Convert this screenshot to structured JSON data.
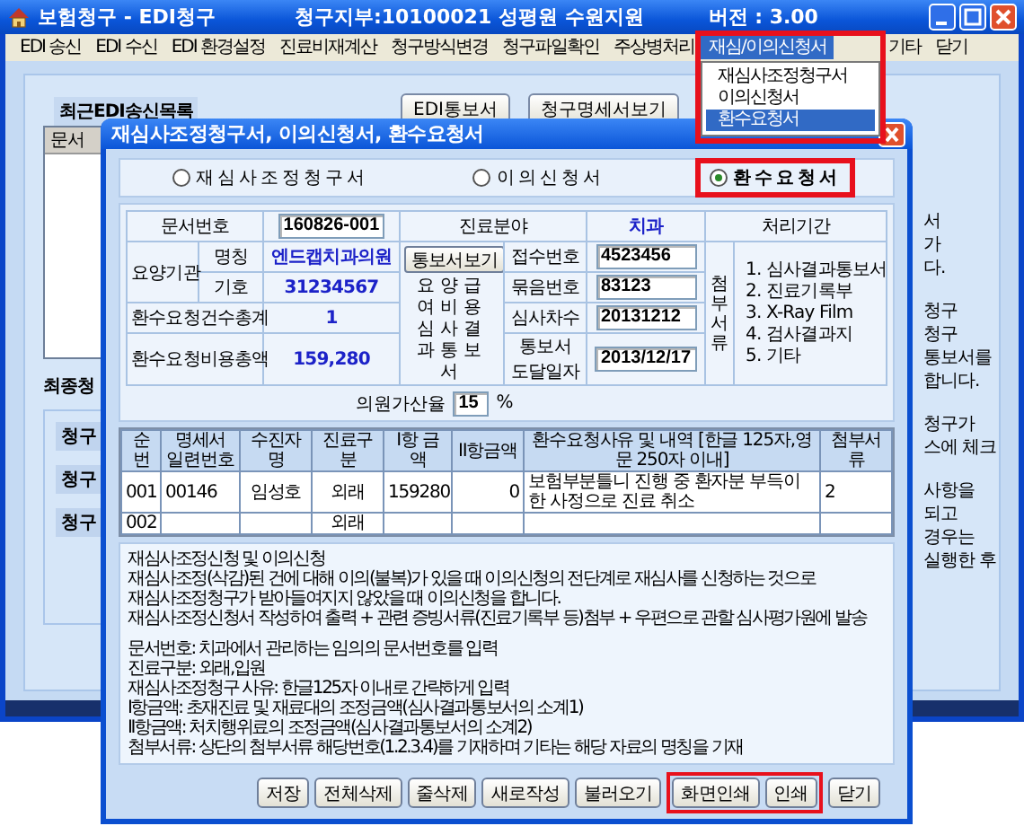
{
  "window": {
    "title": "보험청구 - EDI청구",
    "branch": "청구지부:10100021 성평원 수원지원",
    "version": "버전 : 3.00"
  },
  "menu": [
    {
      "label": "EDI 송신",
      "selected": false,
      "highlighted": false
    },
    {
      "label": "EDI 수신",
      "selected": false,
      "highlighted": false
    },
    {
      "label": "EDI 환경설정",
      "selected": false,
      "highlighted": false
    },
    {
      "label": "진료비재계산",
      "selected": false,
      "highlighted": false
    },
    {
      "label": "청구방식변경",
      "selected": false,
      "highlighted": false
    },
    {
      "label": "청구파일확인",
      "selected": false,
      "highlighted": false
    },
    {
      "label": "주상병처리",
      "selected": false,
      "highlighted": false
    },
    {
      "label": "재심/이의신청서",
      "selected": true,
      "highlighted": true
    },
    {
      "label": "기타",
      "selected": false,
      "highlighted": false
    },
    {
      "label": "닫기",
      "selected": false,
      "highlighted": false
    }
  ],
  "dropdown": [
    {
      "label": "재심사조정청구서",
      "selected": false
    },
    {
      "label": "이의신청서",
      "selected": false
    },
    {
      "label": "환수요청서",
      "selected": true
    }
  ],
  "background": {
    "list_title": "최근EDI송신목록",
    "list_header": "문서",
    "buttons": [
      "EDI통보서",
      "청구명세서보기"
    ],
    "final_title": "최종청",
    "final_labels": [
      "청구",
      "청구",
      "청구"
    ],
    "side_text": [
      [
        "서",
        "가",
        "다."
      ],
      [
        "청구",
        "청구",
        "통보서를",
        "합니다."
      ],
      [
        "청구가",
        "스에 체크"
      ],
      [
        "사항을",
        "되고",
        "경우는",
        "실행한 후"
      ]
    ]
  },
  "dialog": {
    "title": "재심사조정청구서, 이의신청서, 환수요청서",
    "form_types": [
      {
        "label": "재심사조정청구서",
        "selected": false,
        "highlighted": false
      },
      {
        "label": "이의신청서",
        "selected": false,
        "highlighted": false
      },
      {
        "label": "환수요청서",
        "selected": true,
        "highlighted": true
      }
    ],
    "form": {
      "doc_no_label": "문서번호",
      "doc_no": "160826-001",
      "field_label": "진료분야",
      "field": "치과",
      "period_label": "처리기간",
      "institution_label": "요양기관",
      "name_label": "명칭",
      "name": "엔드캡치과의원",
      "code_label": "기호",
      "code": "31234567",
      "notice_button": "통보서보기",
      "notice_label": "요양급여비용심사결과통보서",
      "receipt_label": "접수번호",
      "receipt": "4523456",
      "bundle_label": "묶음번호",
      "bundle": "83123",
      "round_label": "심사차수",
      "round": "20131212",
      "arrival_label": "통보서 도달일자",
      "arrival": "2013/12/17",
      "count_label": "환수요청건수총계",
      "count": "1",
      "total_label": "환수요청비용총액",
      "total": "159,280",
      "attach_label": "첨부서류",
      "attachments": [
        "1. 심사결과통보서",
        "2. 진료기록부",
        "3. X-Ray Film",
        "4. 검사결과지",
        "5. 기타"
      ],
      "rate_label": "의원가산율",
      "rate": "15",
      "rate_unit": "%"
    },
    "table": {
      "columns": [
        "순번",
        "명세서 일련번호",
        "수진자명",
        "진료구분",
        "I항 금액",
        "II항금액",
        "환수요청사유 및 내역 [한글 125자,영문 250자 이내]",
        "첨부서류"
      ],
      "rows": [
        {
          "no": "001",
          "serial": "00146",
          "patient": "임성호",
          "visit_type": "외래",
          "amount_1": "159280",
          "amount_2": "0",
          "reason": "보험부분틀니 진행 중 환자분 부득이한 사정으로 진료 취소",
          "attachments": "2"
        },
        {
          "no": "002",
          "visit_type": "외래"
        }
      ]
    },
    "notes": [
      [
        "재심사조정신청 및 이의신청",
        "재심사조정(삭감)된 건에 대해 이의(불복)가 있을 때 이의신청의 전단계로 재심사를 신청하는 것으로",
        "재심사조정청구가 받아들여지지 않았을 때 이의신청을 합니다.",
        "재심사조정신청서 작성하여 출력 + 관련 증빙서류(진료기록부 등)첨부 + 우편으로 관할 심사평가원에 발송"
      ],
      [
        "문서번호: 치과에서 관리하는 임의의 문서번호를 입력",
        "진료구분: 외래,입원",
        "재심사조정청구 사유:  한글125자 이내로 간략하게 입력",
        "I항금액: 초재진료 및 재료대의 조정금액(심사결과통보서의 소계1)",
        "II항금액: 처치행위료의 조정금액(심사결과통보서의 소계2)",
        "첨부서류: 상단의 첨부서류 해당번호(1.2.3.4)를 기재하며 기타는 해당 자료의 명칭을 기재"
      ]
    ],
    "buttons": [
      {
        "label": "저장",
        "highlighted": false
      },
      {
        "label": "전체삭제",
        "highlighted": false
      },
      {
        "label": "줄삭제",
        "highlighted": false
      },
      {
        "label": "새로작성",
        "highlighted": false
      },
      {
        "label": "불러오기",
        "highlighted": false
      },
      {
        "label": "화면인쇄",
        "highlighted": true
      },
      {
        "label": "인쇄",
        "highlighted": true
      },
      {
        "label": "닫기",
        "highlighted": false
      }
    ]
  }
}
